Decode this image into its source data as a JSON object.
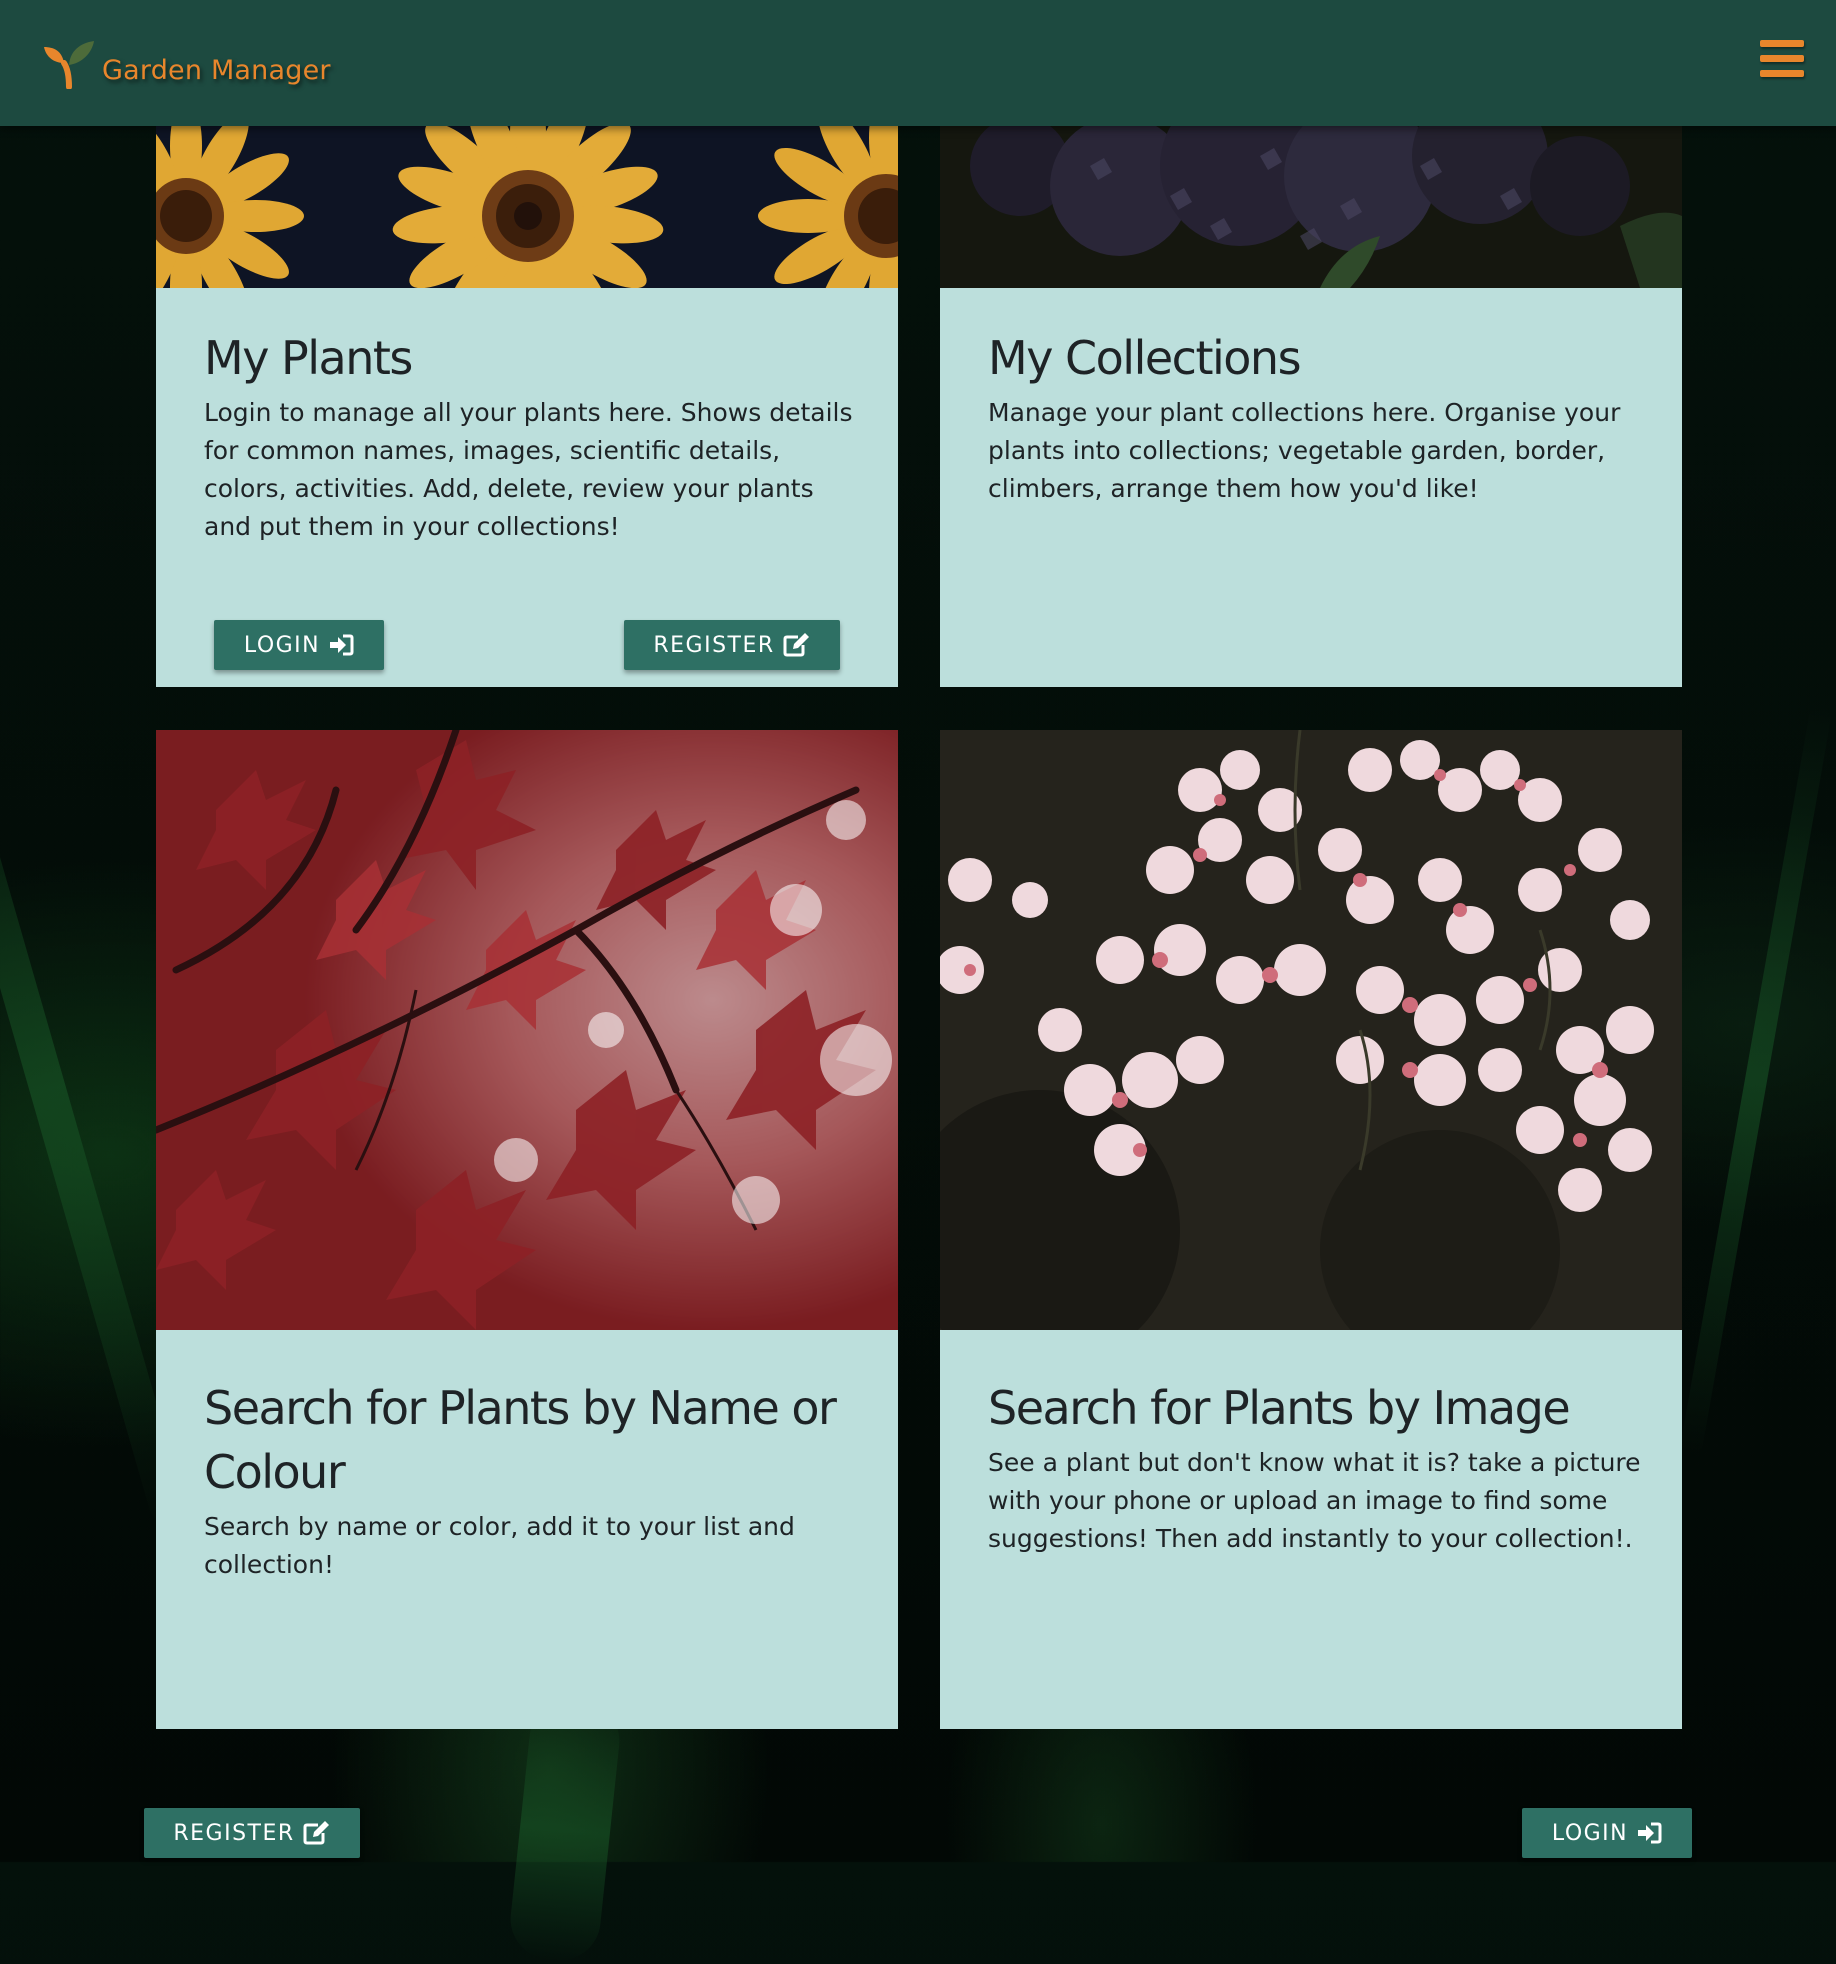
{
  "header": {
    "brand_name": "Garden Manager",
    "logo_icon": "sprout-icon",
    "menu_icon": "hamburger-menu-icon"
  },
  "cards": [
    {
      "title": "My Plants",
      "text": "Login to manage all your plants here. Shows details for common names, images, scientific details, colors, activities. Add, delete, review your plants and put them in your collections!",
      "image": "sunflowers",
      "buttons": [
        {
          "label": "LOGIN",
          "icon": "sign-in-icon"
        },
        {
          "label": "REGISTER",
          "icon": "edit-icon"
        }
      ]
    },
    {
      "title": "My Collections",
      "text": "Manage your plant collections here. Organise your plants into collections; vegetable garden, border, climbers, arrange them how you'd like!",
      "image": "dark-hydrangea"
    },
    {
      "title": "Search for Plants by Name or Colour",
      "text": "Search by name or color, add it to your list and collection!",
      "image": "red-maple-leaves"
    },
    {
      "title": "Search for Plants by Image",
      "text": "See a plant but don't know what it is? take a picture with your phone or upload an image to find some suggestions! Then add instantly to your collection!.",
      "image": "pink-white-blossoms"
    }
  ],
  "footer": {
    "register_label": "REGISTER",
    "login_label": "LOGIN"
  },
  "colors": {
    "header_bg": "#1d4a40",
    "accent_orange": "#e8862c",
    "card_bg": "#bcdfdc",
    "button_bg": "#2e7064",
    "text_dark": "#1e2326"
  }
}
